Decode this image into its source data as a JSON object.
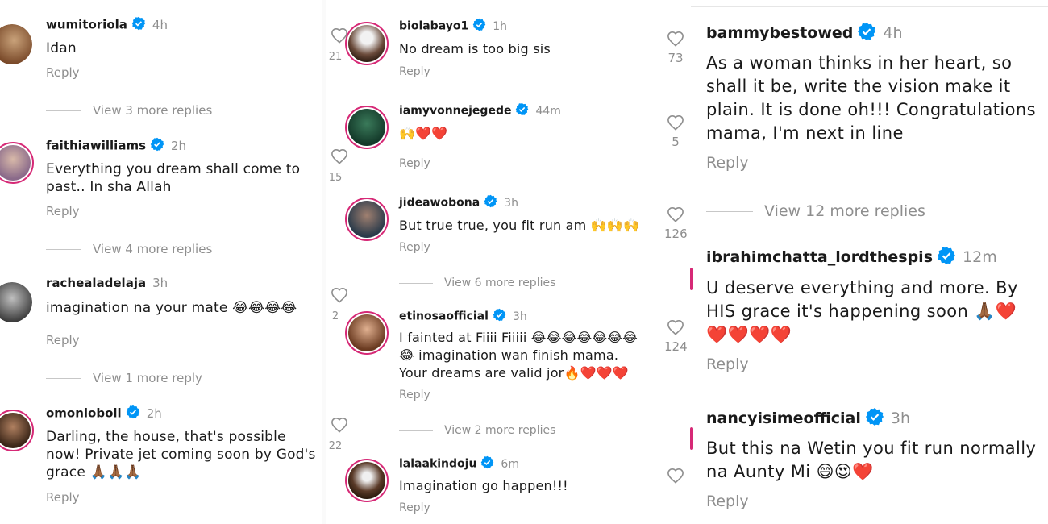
{
  "colors": {
    "accent": "#0095f6",
    "muted": "#8e8e8e",
    "ring": "#d62976"
  },
  "icons": {
    "verified": "verified-badge-icon",
    "like": "heart-outline-icon"
  },
  "panel1": {
    "comments": [
      {
        "username": "wumitoriola",
        "time": "4h",
        "text": "Idan",
        "reply": "Reply",
        "view_more": "View 3 more replies"
      },
      {
        "username": "faithiawilliams",
        "time": "2h",
        "text": "Everything you dream shall come to past.. In sha Allah",
        "reply": "Reply",
        "view_more": "View 4 more replies"
      },
      {
        "username": "rachealadelaja",
        "time": "3h",
        "text": "imagination na your mate 😂😂😂😂",
        "reply": "Reply",
        "view_more": "View 1 more reply"
      },
      {
        "username": "omonioboli",
        "time": "2h",
        "text": "Darling, the house, that's possible now! Private jet coming soon by God's grace 🙏🏾🙏🏾🙏🏾",
        "reply": "Reply"
      }
    ]
  },
  "panel2": {
    "comments": [
      {
        "username": "biolabayo1",
        "time": "1h",
        "text": "No dream is too big sis",
        "reply": "Reply",
        "likes": "21"
      },
      {
        "username": "iamyvonnejegede",
        "time": "44m",
        "text": "🙌❤️❤️",
        "reply": "Reply",
        "likes": "15"
      },
      {
        "username": "jideawobona",
        "time": "3h",
        "text": "But true true, you fit run am 🙌🙌🙌",
        "reply": "Reply",
        "view_more": "View 6 more replies",
        "likes": "2"
      },
      {
        "username": "etinosaofficial",
        "time": "3h",
        "text": "I fainted at Fiiii Fiiiii 😂😂😂😂😂😂😂😂 imagination wan finish mama. Your dreams are valid jor🔥❤️❤️❤️",
        "reply": "Reply",
        "view_more": "View 2 more replies",
        "likes": "22"
      },
      {
        "username": "lalaakindoju",
        "time": "6m",
        "text": "Imagination go happen!!!",
        "reply": "Reply"
      }
    ]
  },
  "panel3": {
    "comments": [
      {
        "username": "bammybestowed",
        "time": "4h",
        "text": "As a woman thinks in her heart, so shall it be, write the vision make it plain. It is done oh!!! Congratulations mama, I'm next in line",
        "reply": "Reply",
        "view_more": "View 12 more replies"
      },
      {
        "username": "ibrahimchatta_lordthespis",
        "time": "12m",
        "text": "U deserve everything and more. By HIS grace it's happening soon 🙏🏾❤️❤️❤️❤️❤️",
        "reply": "Reply"
      },
      {
        "username": "nancyisimeofficial",
        "time": "3h",
        "text": "But this na Wetin you fit run normally na Aunty Mi 😄😍❤️",
        "reply": "Reply"
      }
    ],
    "likes": [
      "73",
      "5",
      "126",
      "124"
    ]
  }
}
